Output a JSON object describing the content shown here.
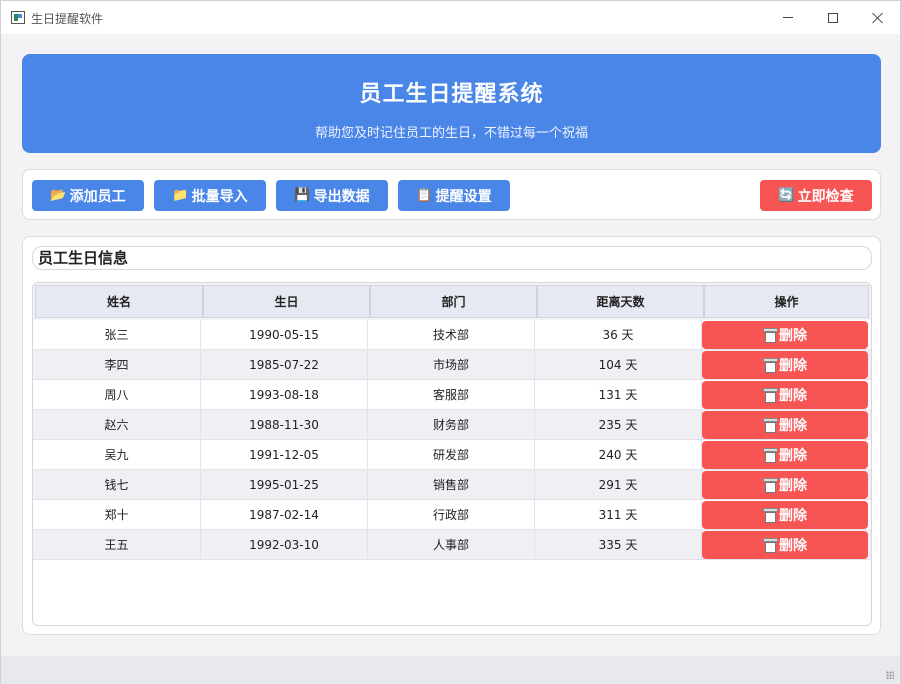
{
  "window": {
    "title": "生日提醒软件"
  },
  "banner": {
    "title": "员工生日提醒系统",
    "subtitle": "帮助您及时记住员工的生日，不错过每一个祝福"
  },
  "toolbar": {
    "add_label": "添加员工",
    "add_icon": "📂",
    "import_label": "批量导入",
    "import_icon": "📁",
    "export_label": "导出数据",
    "export_icon": "💾",
    "settings_label": "提醒设置",
    "settings_icon": "📋",
    "check_label": "立即检查",
    "check_icon": "🔄"
  },
  "section": {
    "title": "员工生日信息"
  },
  "table": {
    "columns": [
      "姓名",
      "生日",
      "部门",
      "距离天数",
      "操作"
    ],
    "delete_label": "删除",
    "rows": [
      {
        "name": "张三",
        "birthday": "1990-05-15",
        "dept": "技术部",
        "days": "36 天"
      },
      {
        "name": "李四",
        "birthday": "1985-07-22",
        "dept": "市场部",
        "days": "104 天"
      },
      {
        "name": "周八",
        "birthday": "1993-08-18",
        "dept": "客服部",
        "days": "131 天"
      },
      {
        "name": "赵六",
        "birthday": "1988-11-30",
        "dept": "财务部",
        "days": "235 天"
      },
      {
        "name": "吴九",
        "birthday": "1991-12-05",
        "dept": "研发部",
        "days": "240 天"
      },
      {
        "name": "钱七",
        "birthday": "1995-01-25",
        "dept": "销售部",
        "days": "291 天"
      },
      {
        "name": "郑十",
        "birthday": "1987-02-14",
        "dept": "行政部",
        "days": "311 天"
      },
      {
        "name": "王五",
        "birthday": "1992-03-10",
        "dept": "人事部",
        "days": "335 天"
      }
    ]
  },
  "colors": {
    "primary": "#4a86e8",
    "danger": "#f75454",
    "background": "#f3f3f6"
  }
}
